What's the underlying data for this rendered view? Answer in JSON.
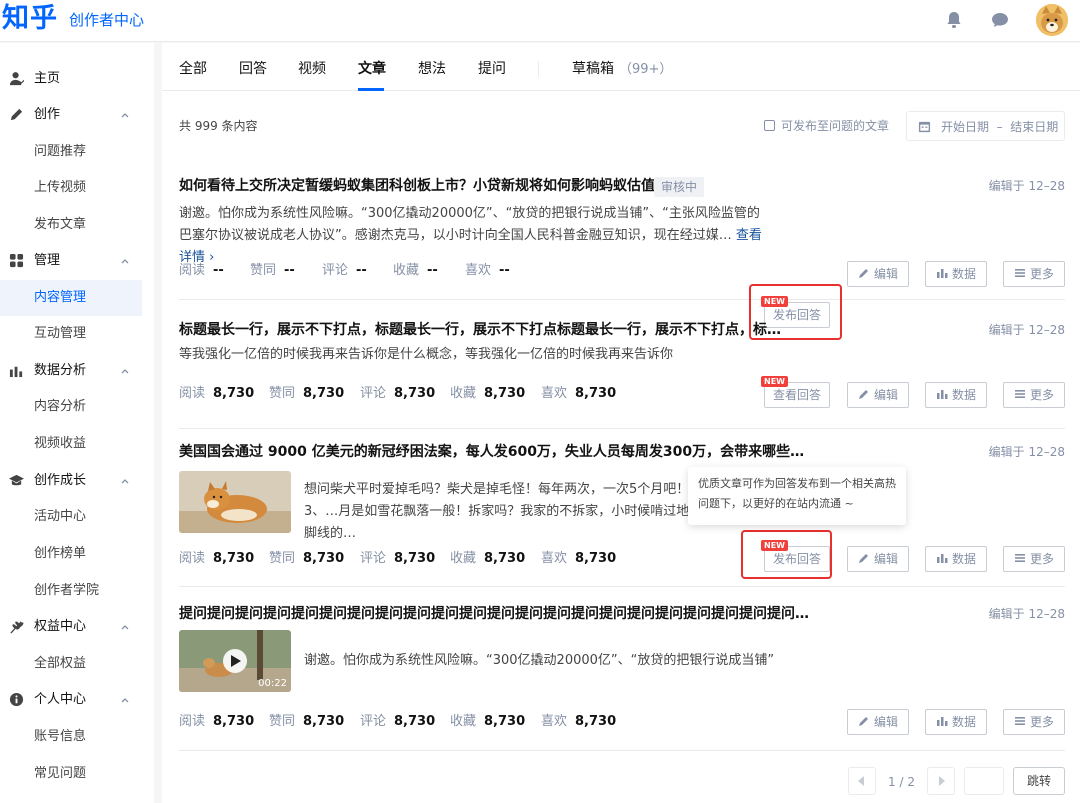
{
  "header": {
    "logo": "知乎",
    "subtitle": "创作者中心",
    "icons": [
      "bell-icon",
      "chat-bubble-icon"
    ],
    "accent_color": "#0066ff"
  },
  "sidebar": {
    "groups": [
      {
        "label": "主页",
        "icon": "user-icon",
        "expandable": false,
        "items": []
      },
      {
        "label": "创作",
        "icon": "pencil-icon",
        "expandable": true,
        "items": [
          "问题推荐",
          "上传视频",
          "发布文章"
        ]
      },
      {
        "label": "管理",
        "icon": "grid-icon",
        "expandable": true,
        "items": [
          "内容管理",
          "互动管理"
        ]
      },
      {
        "label": "数据分析",
        "icon": "bar-chart-icon",
        "expandable": true,
        "items": [
          "内容分析",
          "视频收益"
        ]
      },
      {
        "label": "创作成长",
        "icon": "graduation-cap-icon",
        "expandable": true,
        "items": [
          "活动中心",
          "创作榜单",
          "创作者学院"
        ]
      },
      {
        "label": "权益中心",
        "icon": "wheat-icon",
        "expandable": true,
        "items": [
          "全部权益"
        ]
      },
      {
        "label": "个人中心",
        "icon": "info-icon",
        "expandable": true,
        "items": [
          "账号信息",
          "常见问题"
        ]
      }
    ],
    "active_item": "内容管理"
  },
  "tabs": {
    "items": [
      "全部",
      "回答",
      "视频",
      "文章",
      "想法",
      "提问"
    ],
    "active": "文章",
    "drafts_label": "草稿箱",
    "drafts_count": "（99+）"
  },
  "toolbar": {
    "total": "共 999 条内容",
    "checkbox_label": "可发布至问题的文章",
    "date_start": "开始日期",
    "date_sep": "–",
    "date_end": "结束日期"
  },
  "stat_labels": [
    "阅读",
    "赞同",
    "评论",
    "收藏",
    "喜欢"
  ],
  "articles": [
    {
      "title": "如何看待上交所决定暂缓蚂蚁集团科创板上市？小贷新规将如何影响蚂蚁估值？",
      "badge": "审核中",
      "date": "编辑于 12–28",
      "excerpt": "谢邀。怕你成为系统性风险嘛。“300亿撬动20000亿”、“放贷的把银行说成当铺”、“主张风险监管的巴塞尔协议被说成老人协议”。感谢杰克马，以小时计向全国人民科普金融豆知识，现在经过媒…",
      "more": "查看详情",
      "stats": [
        "--",
        "--",
        "--",
        "--",
        "--"
      ],
      "primary_button": "发布回答",
      "buttons": [
        "编辑",
        "数据",
        "更多"
      ]
    },
    {
      "title": "标题最长一行，展示不下打点，标题最长一行，展示不下打点标题最长一行，展示不下打点，标…",
      "date": "编辑于 12–28",
      "excerpt": "等我强化一亿倍的时候我再来告诉你是什么概念，等我强化一亿倍的时候我再来告诉你",
      "stats": [
        "8,730",
        "8,730",
        "8,730",
        "8,730",
        "8,730"
      ],
      "primary_button": "查看回答",
      "buttons": [
        "编辑",
        "数据",
        "更多"
      ]
    },
    {
      "title": "美国国会通过 9000 亿美元的新冠纾困法案，每人发600万，失业人员每周发300万，会带来哪些…",
      "date": "编辑于 12–28",
      "excerpt": "想问柴犬平时爱掉毛吗？柴犬是掉毛怪！每年两次，一次5个月吧！3、…月是如雪花飘落一般！拆家吗？我家的不拆家，小时候啃过地脚线的…",
      "thumbnail": "shiba-dog-photo",
      "stats": [
        "8,730",
        "8,730",
        "8,730",
        "8,730",
        "8,730"
      ],
      "primary_button": "发布回答",
      "buttons": [
        "编辑",
        "数据",
        "更多"
      ]
    },
    {
      "title": "提问提问提问提问提问提问提问提问提问提问提问提问提问提问提问提问提问提问提问提问提问提问…",
      "date": "编辑于 12–28",
      "excerpt": "谢邀。怕你成为系统性风险嘛。“300亿撬动20000亿”、“放贷的把银行说成当铺”",
      "thumbnail": "dog-video-thumbnail",
      "video_duration": "00:22",
      "stats": [
        "8,730",
        "8,730",
        "8,730",
        "8,730",
        "8,730"
      ],
      "buttons": [
        "编辑",
        "数据",
        "更多"
      ]
    }
  ],
  "new_tag": "NEW",
  "tooltip": "优质文章可作为回答发布到一个相关高热问题下，以更好的在站内流通 ~",
  "pagination": {
    "current": "1",
    "sep": "/",
    "total": "2",
    "jump_label": "跳转"
  }
}
